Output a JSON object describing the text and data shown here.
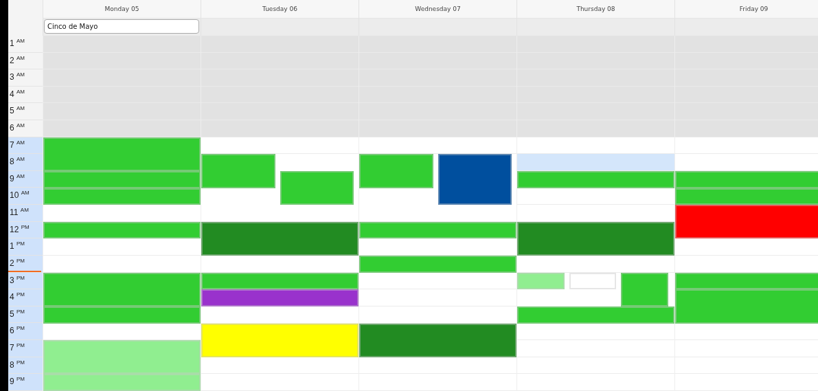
{
  "hours": [
    {
      "label": "1 $^{AM}$",
      "working": false,
      "current": false
    },
    {
      "label": "2 $^{AM}$",
      "working": false,
      "current": false
    },
    {
      "label": "3 $^{AM}$",
      "working": false,
      "current": false
    },
    {
      "label": "4 $^{AM}$",
      "working": false,
      "current": false
    },
    {
      "label": "5 $^{AM}$",
      "working": false,
      "current": false
    },
    {
      "label": "6 $^{AM}$",
      "working": false,
      "current": false
    },
    {
      "label": "7 $^{AM}$",
      "working": true,
      "current": false
    },
    {
      "label": "8 $^{AM}$",
      "working": true,
      "current": false
    },
    {
      "label": "9 $^{AM}$",
      "working": true,
      "current": false
    },
    {
      "label": "10 $^{AM}$",
      "working": true,
      "current": false
    },
    {
      "label": "11 $^{AM}$",
      "working": true,
      "current": false
    },
    {
      "label": "12 $^{PM}$",
      "working": true,
      "current": false
    },
    {
      "label": "1 $^{PM}$",
      "working": true,
      "current": false
    },
    {
      "label": "2 $^{PM}$",
      "working": true,
      "current": true
    },
    {
      "label": "3 $^{PM}$",
      "working": true,
      "current": false
    },
    {
      "label": "4 $^{PM}$",
      "working": true,
      "current": false
    },
    {
      "label": "5 $^{PM}$",
      "working": true,
      "current": false
    },
    {
      "label": "6 $^{PM}$",
      "working": true,
      "current": false
    },
    {
      "label": "7 $^{PM}$",
      "working": true,
      "current": false
    },
    {
      "label": "8 $^{PM}$",
      "working": true,
      "current": false
    },
    {
      "label": "9 $^{PM}$",
      "working": true,
      "current": false
    }
  ],
  "days": [
    {
      "label": "Monday 05",
      "all_day": [
        "Cinco de Mayo"
      ],
      "slots": [
        {
          "selected": false
        },
        {
          "selected": false
        },
        {
          "selected": false
        },
        {
          "selected": false
        },
        {
          "selected": false
        },
        {
          "selected": false
        },
        {
          "events": [
            {
              "color": "#32cd32",
              "kind": "full",
              "continues": true
            }
          ]
        },
        {
          "events": [
            {
              "color": "#32cd32",
              "kind": "full",
              "continues": false
            }
          ]
        },
        {
          "events": [
            {
              "color": "#32cd32",
              "kind": "full",
              "continues": false
            }
          ]
        },
        {
          "events": [
            {
              "color": "#32cd32",
              "kind": "full",
              "continues": false
            }
          ]
        },
        {
          "selected": false
        },
        {
          "events": [
            {
              "color": "#32cd32",
              "kind": "full",
              "continues": false
            }
          ]
        },
        {
          "selected": false
        },
        {
          "selected": false
        },
        {
          "events": [
            {
              "color": "#32cd32",
              "kind": "full",
              "continues": true
            }
          ]
        },
        {
          "events": [
            {
              "color": "#32cd32",
              "kind": "full",
              "continues": false
            }
          ]
        },
        {
          "events": [
            {
              "color": "#32cd32",
              "kind": "full",
              "continues": false
            }
          ]
        },
        {
          "selected": false
        },
        {
          "events": [
            {
              "color": "#90ee90",
              "kind": "full",
              "continues": true
            }
          ]
        },
        {
          "events": [
            {
              "color": "#90ee90",
              "kind": "full",
              "continues": false
            }
          ]
        },
        {
          "events": [
            {
              "color": "#90ee90",
              "kind": "full",
              "continues": false
            }
          ]
        }
      ]
    },
    {
      "label": "Tuesday 06",
      "slots": [
        {
          "selected": false
        },
        {
          "selected": false
        },
        {
          "selected": false
        },
        {
          "selected": false
        },
        {
          "selected": false
        },
        {
          "selected": false
        },
        {
          "selected": false
        },
        {
          "events": [
            {
              "color": "#32cd32",
              "kind": "left",
              "continues": true
            }
          ]
        },
        {
          "events": [
            {
              "color": "#32cd32",
              "kind": "left",
              "continues": false
            },
            {
              "color": "#32cd32",
              "kind": "right",
              "continues": true
            }
          ]
        },
        {
          "events": [
            {
              "color": "#32cd32",
              "kind": "right",
              "continues": false
            }
          ]
        },
        {
          "selected": false
        },
        {
          "events": [
            {
              "color": "#228b22",
              "kind": "full",
              "continues": true
            }
          ]
        },
        {
          "events": [
            {
              "color": "#228b22",
              "kind": "full",
              "continues": false
            }
          ]
        },
        {
          "selected": false
        },
        {
          "events": [
            {
              "color": "#32cd32",
              "kind": "full",
              "continues": false
            }
          ]
        },
        {
          "events": [
            {
              "color": "#9932cc",
              "kind": "full",
              "continues": false
            }
          ]
        },
        {
          "selected": false
        },
        {
          "events": [
            {
              "color": "#ffff00",
              "kind": "full",
              "continues": true
            }
          ]
        },
        {
          "events": [
            {
              "color": "#ffff00",
              "kind": "full",
              "continues": false
            }
          ]
        },
        {
          "selected": false
        },
        {
          "selected": false
        }
      ]
    },
    {
      "label": "Wednesday 07",
      "slots": [
        {
          "selected": false
        },
        {
          "selected": false
        },
        {
          "selected": false
        },
        {
          "selected": false
        },
        {
          "selected": false
        },
        {
          "selected": false
        },
        {
          "selected": false
        },
        {
          "events": [
            {
              "color": "#32cd32",
              "kind": "left",
              "continues": true
            },
            {
              "color": "#004f9e",
              "kind": "right",
              "continues": true
            }
          ]
        },
        {
          "events": [
            {
              "color": "#32cd32",
              "kind": "left",
              "continues": false
            },
            {
              "color": "#004f9e",
              "kind": "right",
              "continues": true
            }
          ]
        },
        {
          "events": [
            {
              "color": "#004f9e",
              "kind": "right",
              "continues": false
            }
          ]
        },
        {
          "selected": false
        },
        {
          "events": [
            {
              "color": "#32cd32",
              "kind": "full",
              "continues": false
            }
          ]
        },
        {
          "selected": false
        },
        {
          "events": [
            {
              "color": "#32cd32",
              "kind": "full",
              "continues": false
            }
          ]
        },
        {
          "selected": false
        },
        {
          "selected": false
        },
        {
          "selected": false
        },
        {
          "events": [
            {
              "color": "#228b22",
              "kind": "full",
              "continues": true
            }
          ]
        },
        {
          "events": [
            {
              "color": "#228b22",
              "kind": "full",
              "continues": false
            }
          ]
        },
        {
          "selected": false
        },
        {
          "selected": false
        }
      ]
    },
    {
      "label": "Thursday 08",
      "slots": [
        {
          "selected": false
        },
        {
          "selected": false
        },
        {
          "selected": false
        },
        {
          "selected": false
        },
        {
          "selected": false
        },
        {
          "selected": false
        },
        {
          "selected": false
        },
        {
          "selected": true
        },
        {
          "events": [
            {
              "color": "#32cd32",
              "kind": "full",
              "continues": false
            }
          ]
        },
        {
          "selected": false
        },
        {
          "selected": false
        },
        {
          "events": [
            {
              "color": "#228b22",
              "kind": "full",
              "continues": true
            }
          ]
        },
        {
          "events": [
            {
              "color": "#228b22",
              "kind": "full",
              "continues": false
            }
          ]
        },
        {
          "selected": false
        },
        {
          "events": [
            {
              "color": "#90ee90",
              "kind": "first",
              "continues": false
            },
            {
              "color": "#ffffff",
              "kind": "middle",
              "continues": false
            },
            {
              "color": "#32cd32",
              "kind": "last",
              "continues": true
            }
          ]
        },
        {
          "events": [
            {
              "color": "#32cd32",
              "kind": "last",
              "continues": false
            }
          ]
        },
        {
          "events": [
            {
              "color": "#32cd32",
              "kind": "full",
              "continues": false
            }
          ]
        },
        {
          "selected": false
        },
        {
          "selected": false
        },
        {
          "selected": false
        },
        {
          "selected": false
        }
      ]
    },
    {
      "label": "Friday 09",
      "slots": [
        {
          "selected": false
        },
        {
          "selected": false
        },
        {
          "selected": false
        },
        {
          "selected": false
        },
        {
          "selected": false
        },
        {
          "selected": false
        },
        {
          "selected": false
        },
        {
          "selected": false
        },
        {
          "events": [
            {
              "color": "#32cd32",
              "kind": "full",
              "continues": false
            }
          ]
        },
        {
          "events": [
            {
              "color": "#32cd32",
              "kind": "full",
              "continues": false
            }
          ]
        },
        {
          "events": [
            {
              "color": "#ff0000",
              "kind": "full",
              "continues": true
            }
          ]
        },
        {
          "events": [
            {
              "color": "#ff0000",
              "kind": "full",
              "continues": false
            }
          ]
        },
        {
          "selected": false
        },
        {
          "selected": false
        },
        {
          "events": [
            {
              "color": "#32cd32",
              "kind": "full",
              "continues": false
            }
          ]
        },
        {
          "events": [
            {
              "color": "#32cd32",
              "kind": "full",
              "continues": true
            }
          ]
        },
        {
          "events": [
            {
              "color": "#32cd32",
              "kind": "full",
              "continues": false
            }
          ]
        },
        {
          "selected": false
        },
        {
          "selected": false
        },
        {
          "selected": false
        },
        {
          "selected": false
        }
      ]
    }
  ]
}
